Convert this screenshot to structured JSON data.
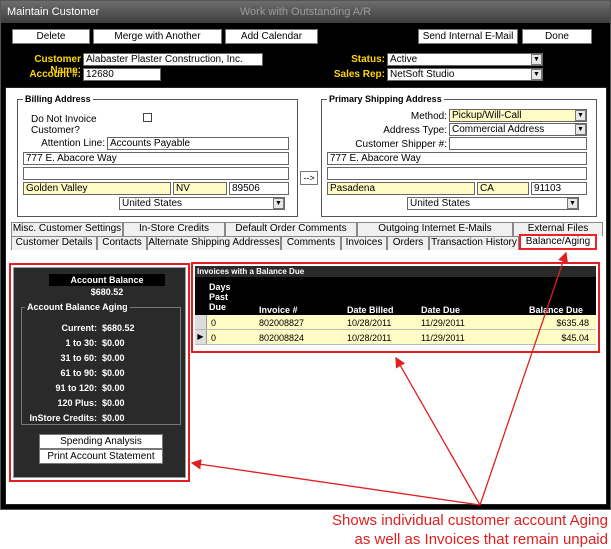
{
  "window": {
    "title": "Maintain Customer",
    "subtitle": "Work with Outstanding A/R"
  },
  "toolbar": {
    "delete_customer": "Delete Customer",
    "merge_customer": "Merge with Another Customer",
    "add_calendar_event": "Add Calendar Event",
    "send_email": "Send Internal E-Mail",
    "done": "Done"
  },
  "customer": {
    "name_label": "Customer Name:",
    "name": "Alabaster Plaster Construction, Inc.",
    "account_label": "Account #:",
    "account": "12680",
    "status_label": "Status:",
    "status": "Active",
    "salesrep_label": "Sales Rep:",
    "salesrep": "NetSoft Studio"
  },
  "billing": {
    "title": "Billing Address",
    "do_not_invoice_label": "Do Not Invoice Customer?",
    "attention_label": "Attention Line:",
    "attention": "Accounts Payable",
    "street1": "777 E. Abacore Way",
    "street2": "",
    "city": "Golden Valley",
    "state": "NV",
    "zip": "89506",
    "country": "United States"
  },
  "copy_button": "-->",
  "shipping": {
    "title": "Primary Shipping Address",
    "method_label": "Method:",
    "method": "Pickup/Will-Call",
    "address_type_label": "Address Type:",
    "address_type": "Commercial Address",
    "shipper_label": "Customer Shipper #:",
    "shipper": "",
    "street1": "777 E. Abacore Way",
    "street2": "",
    "city": "Pasadena",
    "state": "CA",
    "zip": "91103",
    "country": "United States"
  },
  "tabs_row1": [
    "Misc. Customer Settings",
    "In-Store Credits",
    "Default Order Comments",
    "Outgoing Internet E-Mails",
    "External Files"
  ],
  "tabs_row2": [
    "Customer Details",
    "Contacts",
    "Alternate Shipping Addresses",
    "Comments",
    "Invoices",
    "Orders",
    "Transaction History",
    "Balance/Aging"
  ],
  "balance": {
    "title": "Account Balance",
    "amount": "$680.52",
    "aging_title": "Account Balance Aging",
    "rows": [
      {
        "label": "Current:",
        "value": "$680.52"
      },
      {
        "label": "1 to 30:",
        "value": "$0.00"
      },
      {
        "label": "31 to 60:",
        "value": "$0.00"
      },
      {
        "label": "61 to 90:",
        "value": "$0.00"
      },
      {
        "label": "91 to 120:",
        "value": "$0.00"
      },
      {
        "label": "120 Plus:",
        "value": "$0.00"
      },
      {
        "label": "InStore Credits:",
        "value": "$0.00"
      }
    ],
    "spending_analysis": "Spending Analysis",
    "print_statement": "Print Account Statement"
  },
  "invoices": {
    "title": "Invoices with a Balance Due",
    "headers": {
      "days_past_due": "Days\nPast\nDue",
      "invoice": "Invoice #",
      "date_billed": "Date Billed",
      "date_due": "Date Due",
      "balance_due": "Balance Due"
    },
    "rows": [
      {
        "days": "0",
        "invoice": "802008827",
        "billed": "10/28/2011",
        "due": "11/29/2011",
        "balance": "$635.48"
      },
      {
        "days": "0",
        "invoice": "802008824",
        "billed": "10/28/2011",
        "due": "11/29/2011",
        "balance": "$45.04"
      }
    ]
  },
  "callout": {
    "line1": "Shows individual customer account Aging",
    "line2": "as well as Invoices that remain unpaid"
  }
}
